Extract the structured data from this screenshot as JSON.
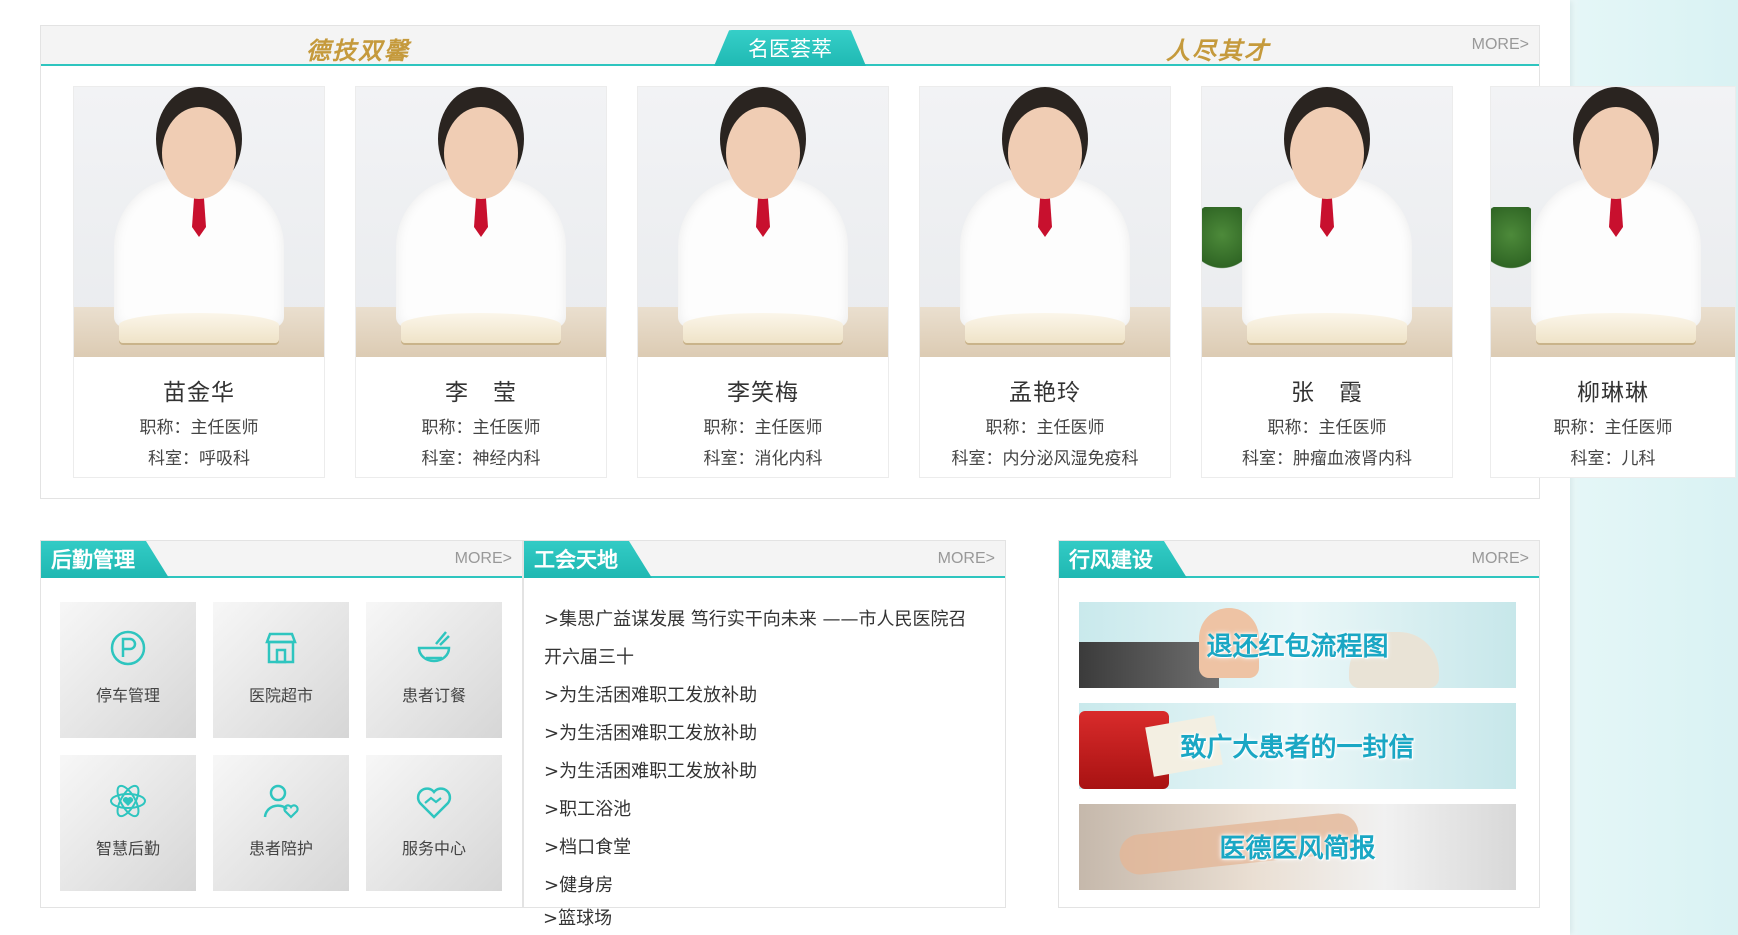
{
  "doctors_section": {
    "slogan_left": "德技双馨",
    "tab_label": "名医荟萃",
    "slogan_right": "人尽其才",
    "more_label": "MORE>",
    "doctors": [
      {
        "name": "苗金华",
        "title": "职称：主任医师",
        "dept": "科室：呼吸科"
      },
      {
        "name": "李　莹",
        "title": "职称：主任医师",
        "dept": "科室：神经内科"
      },
      {
        "name": "李笑梅",
        "title": "职称：主任医师",
        "dept": "科室：消化内科"
      },
      {
        "name": "孟艳玲",
        "title": "职称：主任医师",
        "dept": "科室：内分泌风湿免疫科"
      },
      {
        "name": "张　霞",
        "title": "职称：主任医师",
        "dept": "科室：肿瘤血液肾内科"
      },
      {
        "name": "柳琳琳",
        "title": "职称：主任医师",
        "dept": "科室：儿科"
      }
    ]
  },
  "logistics": {
    "title": "后勤管理",
    "more_label": "MORE>",
    "tiles": [
      {
        "label": "停车管理",
        "icon": "parking-icon"
      },
      {
        "label": "医院超市",
        "icon": "store-icon"
      },
      {
        "label": "患者订餐",
        "icon": "meal-bowl-icon"
      },
      {
        "label": "智慧后勤",
        "icon": "atom-heart-icon"
      },
      {
        "label": "患者陪护",
        "icon": "caregiver-icon"
      },
      {
        "label": "服务中心",
        "icon": "handshake-heart-icon"
      }
    ],
    "icon_color": "#2ec5bf"
  },
  "union": {
    "title": "工会天地",
    "more_label": "MORE>",
    "items": [
      ">集思广益谋发展 笃行实干向未来 ——市人民医院召",
      "开六届三十",
      ">为生活困难职工发放补助",
      ">为生活困难职工发放补助",
      ">为生活困难职工发放补助",
      ">职工浴池",
      ">档口食堂",
      ">健身房",
      ">篮球场"
    ]
  },
  "conduct": {
    "title": "行风建设",
    "more_label": "MORE>",
    "banners": [
      {
        "text": "退还红包流程图"
      },
      {
        "text": "致广大患者的一封信"
      },
      {
        "text": "医德医风简报"
      }
    ]
  },
  "colors": {
    "accent": "#2ec5bf",
    "slogan_gold": "#c59a3c",
    "banner_text": "#1aa7c4"
  }
}
